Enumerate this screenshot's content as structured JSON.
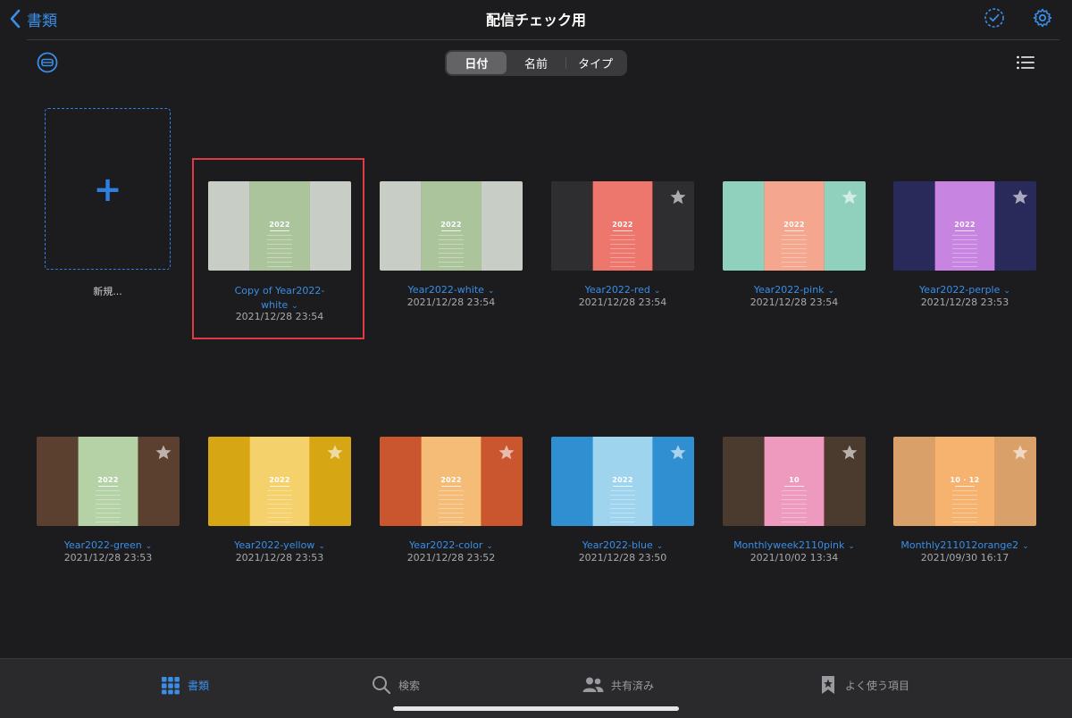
{
  "nav": {
    "back_label": "書類",
    "title": "配信チェック用"
  },
  "sort": {
    "options": [
      "日付",
      "名前",
      "タイプ"
    ],
    "selected": "日付"
  },
  "new_document": {
    "label": "新規..."
  },
  "documents": [
    {
      "name": "Copy of Year2022-white",
      "date": "2021/12/28 23:54",
      "thumb_year": "2022",
      "colors": [
        "#c8cdc6",
        "#8fb07a"
      ],
      "selected": true
    },
    {
      "name": "Year2022-white",
      "date": "2021/12/28 23:54",
      "thumb_year": "2022",
      "colors": [
        "#c8cdc6",
        "#8fb07a"
      ]
    },
    {
      "name": "Year2022-red",
      "date": "2021/12/28 23:54",
      "thumb_year": "2022",
      "colors": [
        "#2e2e30",
        "#e84a3d"
      ]
    },
    {
      "name": "Year2022-pink",
      "date": "2021/12/28 23:54",
      "thumb_year": "2022",
      "colors": [
        "#8fd1bd",
        "#f0896a"
      ]
    },
    {
      "name": "Year2022-perple",
      "date": "2021/12/28 23:53",
      "thumb_year": "2022",
      "colors": [
        "#2a2a5a",
        "#b45bd6"
      ]
    },
    {
      "name": "Year2022-green",
      "date": "2021/12/28 23:53",
      "thumb_year": "2022",
      "colors": [
        "#5b4030",
        "#9cc38a"
      ]
    },
    {
      "name": "Year2022-yellow",
      "date": "2021/12/28 23:53",
      "thumb_year": "2022",
      "colors": [
        "#d6a615",
        "#f0c23a"
      ]
    },
    {
      "name": "Year2022-color",
      "date": "2021/12/28 23:52",
      "thumb_year": "2022",
      "colors": [
        "#c9562e",
        "#f0a64a"
      ]
    },
    {
      "name": "Year2022-blue",
      "date": "2021/12/28 23:50",
      "thumb_year": "2022",
      "colors": [
        "#2f8fd1",
        "#7fc6ea"
      ]
    },
    {
      "name": "Monthlyweek2110pink",
      "date": "2021/10/02 13:34",
      "thumb_year": "10",
      "colors": [
        "#4b3a2e",
        "#e879a8"
      ]
    },
    {
      "name": "Monthly211012orange2",
      "date": "2021/09/30 16:17",
      "thumb_year": "10 · 12",
      "colors": [
        "#d9a06a",
        "#f39a3f"
      ]
    }
  ],
  "tabs": [
    {
      "label": "書類",
      "icon": "grid-icon",
      "active": true
    },
    {
      "label": "検索",
      "icon": "search-icon",
      "active": false
    },
    {
      "label": "共有済み",
      "icon": "people-icon",
      "active": false
    },
    {
      "label": "よく使う項目",
      "icon": "bookmark-star-icon",
      "active": false
    }
  ],
  "colors": {
    "accent": "#3a8ee6",
    "background": "#1c1c1e",
    "highlight": "#e23a45"
  }
}
